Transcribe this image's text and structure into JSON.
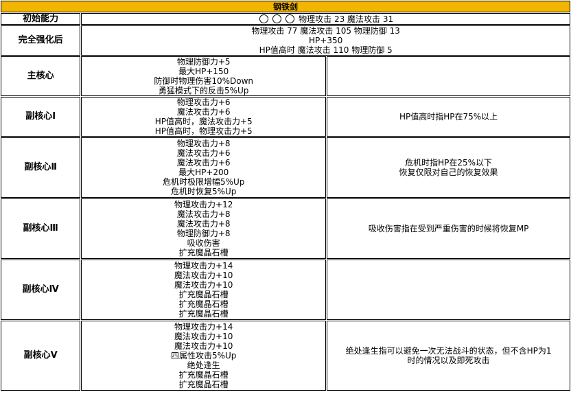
{
  "title": "钢铁剑",
  "initial": {
    "label": "初始能力",
    "slot_icons": [
      "empty-circle",
      "empty-circle",
      "empty-circle"
    ],
    "text": "物理攻击 23 魔法攻击 31"
  },
  "full": {
    "label": "完全强化后",
    "lines": [
      "物理攻击 77 魔法攻击 105 物理防御 13",
      "HP+350",
      "HP值高时 魔法攻击 110 物理防御 5"
    ]
  },
  "rows": [
    {
      "label": "主核心",
      "stats": [
        "物理防御力+5",
        "最大HP+150",
        "防御时物理伤害10%Down",
        "勇猛模式下的反击5%Up"
      ],
      "note": []
    },
    {
      "label": "副核心Ⅰ",
      "stats": [
        "物理攻击力+6",
        "魔法攻击力+6",
        "HP值高时，魔法攻击力+5",
        "HP值高时，物理攻击力+5"
      ],
      "note": [
        "HP值高时指HP在75%以上"
      ]
    },
    {
      "label": "副核心Ⅱ",
      "stats": [
        "物理攻击力+8",
        "魔法攻击力+6",
        "魔法攻击力+6",
        "最大HP+200",
        "危机时极限增幅5%Up",
        "危机时恢复5%Up"
      ],
      "note": [
        "危机时指HP在25%以下",
        "恢复仅限对自己的恢复效果"
      ]
    },
    {
      "label": "副核心Ⅲ",
      "stats": [
        "物理攻击力+12",
        "魔法攻击力+8",
        "魔法攻击力+8",
        "物理防御力+8",
        "吸收伤害",
        "扩充魔晶石槽"
      ],
      "note": [
        "吸收伤害指在受到严重伤害的时候将恢复MP"
      ]
    },
    {
      "label": "副核心Ⅳ",
      "stats": [
        "物理攻击力+14",
        "魔法攻击力+10",
        "魔法攻击力+10",
        "扩充魔晶石槽",
        "扩充魔晶石槽",
        "扩充魔晶石槽"
      ],
      "note": []
    },
    {
      "label": "副核心Ⅴ",
      "stats": [
        "物理攻击力+14",
        "魔法攻击力+10",
        "魔法攻击力+10",
        "四属性攻击5%Up",
        "绝处逢生",
        "扩充魔晶石槽",
        "扩充魔晶石槽"
      ],
      "note": [
        "绝处逢生指可以避免一次无法战斗的状态，但不含HP为1",
        "时的情况以及即死攻击"
      ]
    }
  ]
}
